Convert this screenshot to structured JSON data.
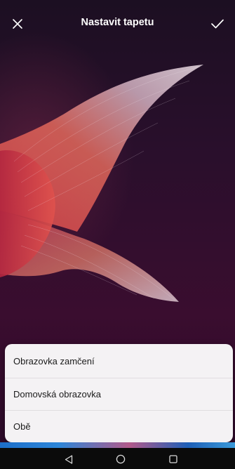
{
  "header": {
    "title": "Nastavit tapetu",
    "close_icon": "close-icon",
    "confirm_icon": "check-icon"
  },
  "options": [
    {
      "label": "Obrazovka zamčení"
    },
    {
      "label": "Domovská obrazovka"
    },
    {
      "label": "Obě"
    }
  ],
  "navigation": {
    "back_icon": "back-triangle-icon",
    "home_icon": "home-circle-icon",
    "recents_icon": "recents-square-icon"
  },
  "colors": {
    "sheet_background": "#f4f2f4",
    "wallpaper_dark": "#2a0f2c",
    "navbar": "#0b0b0b"
  }
}
